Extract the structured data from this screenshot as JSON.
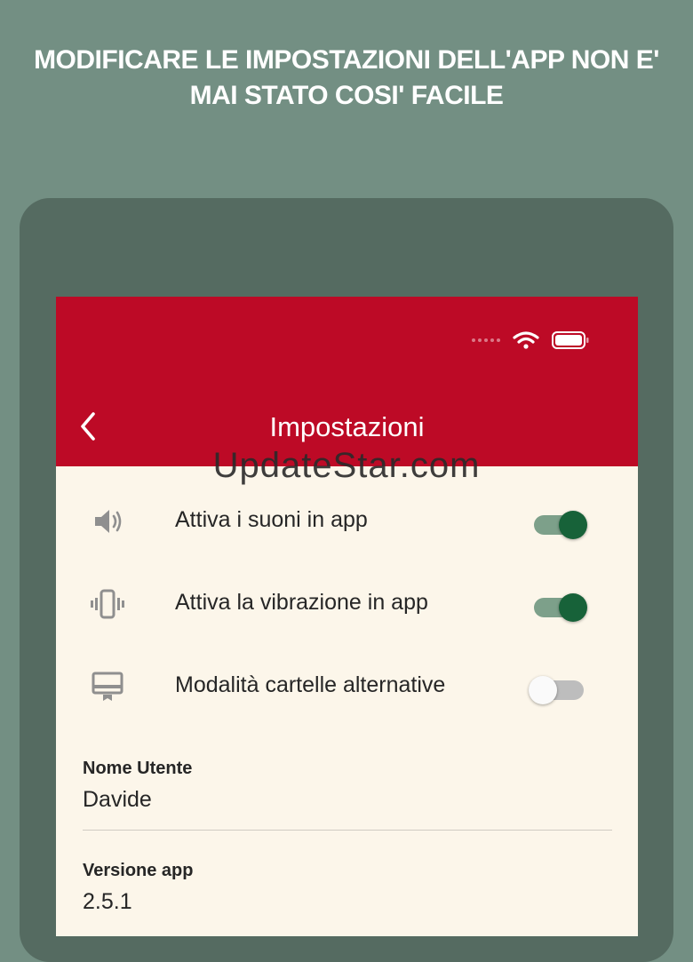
{
  "headline": {
    "line1": "MODIFICARE LE IMPOSTAZIONI DELL'APP NON E'",
    "line2": "MAI STATO COSI' FACILE"
  },
  "appbar": {
    "title": "Impostazioni",
    "back_icon": "chevron-left-icon",
    "color": "#bd0a26"
  },
  "status_bar": {
    "signal_icon": "signal-dots-icon",
    "wifi_icon": "wifi-icon",
    "battery_icon": "battery-icon"
  },
  "watermark": "UpdateStar.com",
  "settings": [
    {
      "icon": "speaker-icon",
      "label": "Attiva i suoni in app",
      "enabled": true
    },
    {
      "icon": "vibration-icon",
      "label": "Attiva la vibrazione in app",
      "enabled": true
    },
    {
      "icon": "card-icon",
      "label": "Modalità cartelle alternative",
      "enabled": false
    }
  ],
  "fields": [
    {
      "label": "Nome Utente",
      "value": "Davide"
    },
    {
      "label": "Versione app",
      "value": "2.5.1"
    }
  ],
  "colors": {
    "background": "#738f83",
    "device": "#556b61",
    "screen": "#fcf6ea",
    "toggle_on": "#176239"
  }
}
